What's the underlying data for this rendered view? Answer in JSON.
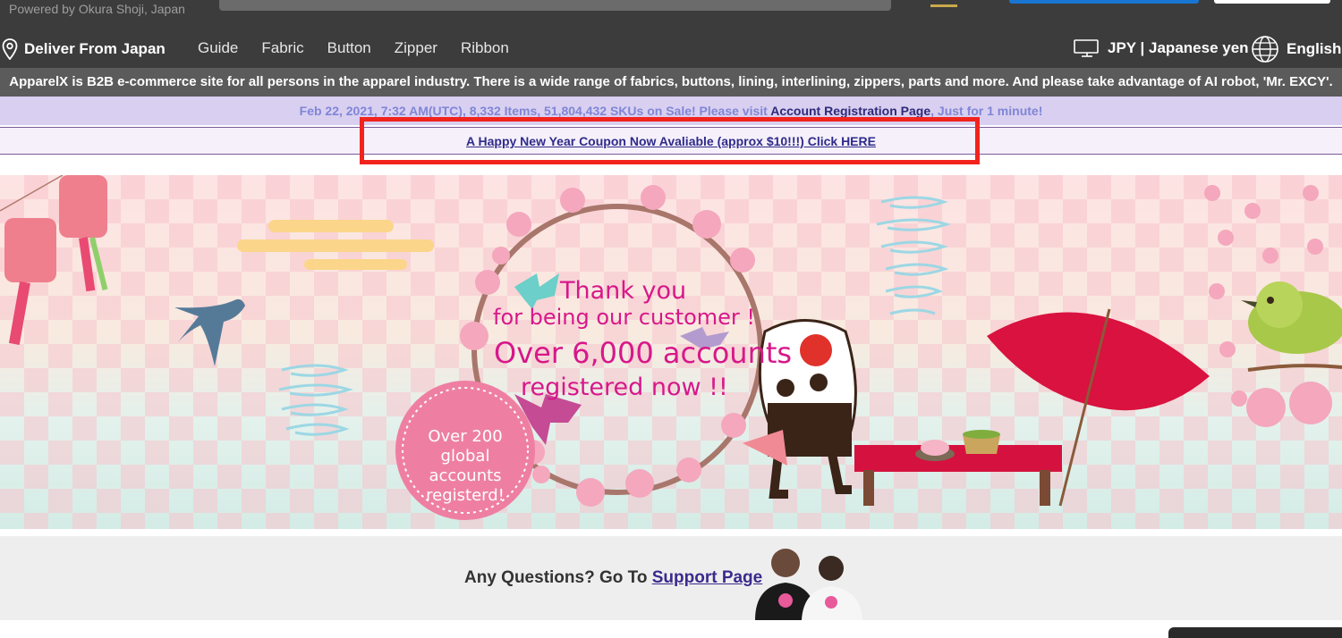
{
  "header": {
    "powered_by": "Powered by Okura Shoji, Japan"
  },
  "nav": {
    "deliver": "Deliver From Japan",
    "links": [
      "Guide",
      "Fabric",
      "Button",
      "Zipper",
      "Ribbon"
    ],
    "currency": "JPY | Japanese yen",
    "language": "English"
  },
  "info_bar": {
    "text": "ApparelX is B2B e-commerce site for all persons in the apparel industry. There is a wide range of fabrics, buttons, lining, interlining, zippers, parts and more. And please take advantage of AI robot, 'Mr. EXCY'."
  },
  "stats_bar": {
    "text_before": "Feb 22, 2021, 7:32 AM(UTC), 8,332 Items, 51,804,432 SKUs on Sale! Please visit ",
    "link_text": "Account Registration Page",
    "text_after": ", Just for 1 minute!"
  },
  "coupon": {
    "link_text": "A Happy New Year Coupon Now Avaliable (approx $10!!!) Click HERE"
  },
  "banner": {
    "line1": "Thank you",
    "line2": "for being our customer !",
    "line3": "Over 6,000 accounts",
    "line4": "registered  now !!",
    "badge_line1": "Over 200",
    "badge_line2": "global accounts",
    "badge_line3": "registerd!"
  },
  "support": {
    "question": "Any Questions? Go To ",
    "link_text": "Support Page"
  },
  "colors": {
    "header_bg": "#3c3c3c",
    "info_bg": "#5b5b5b",
    "stats_bg": "#d9cff0",
    "coupon_link": "#2e2b8a",
    "highlight": "#f2231d",
    "banner_text": "#d7188a"
  }
}
